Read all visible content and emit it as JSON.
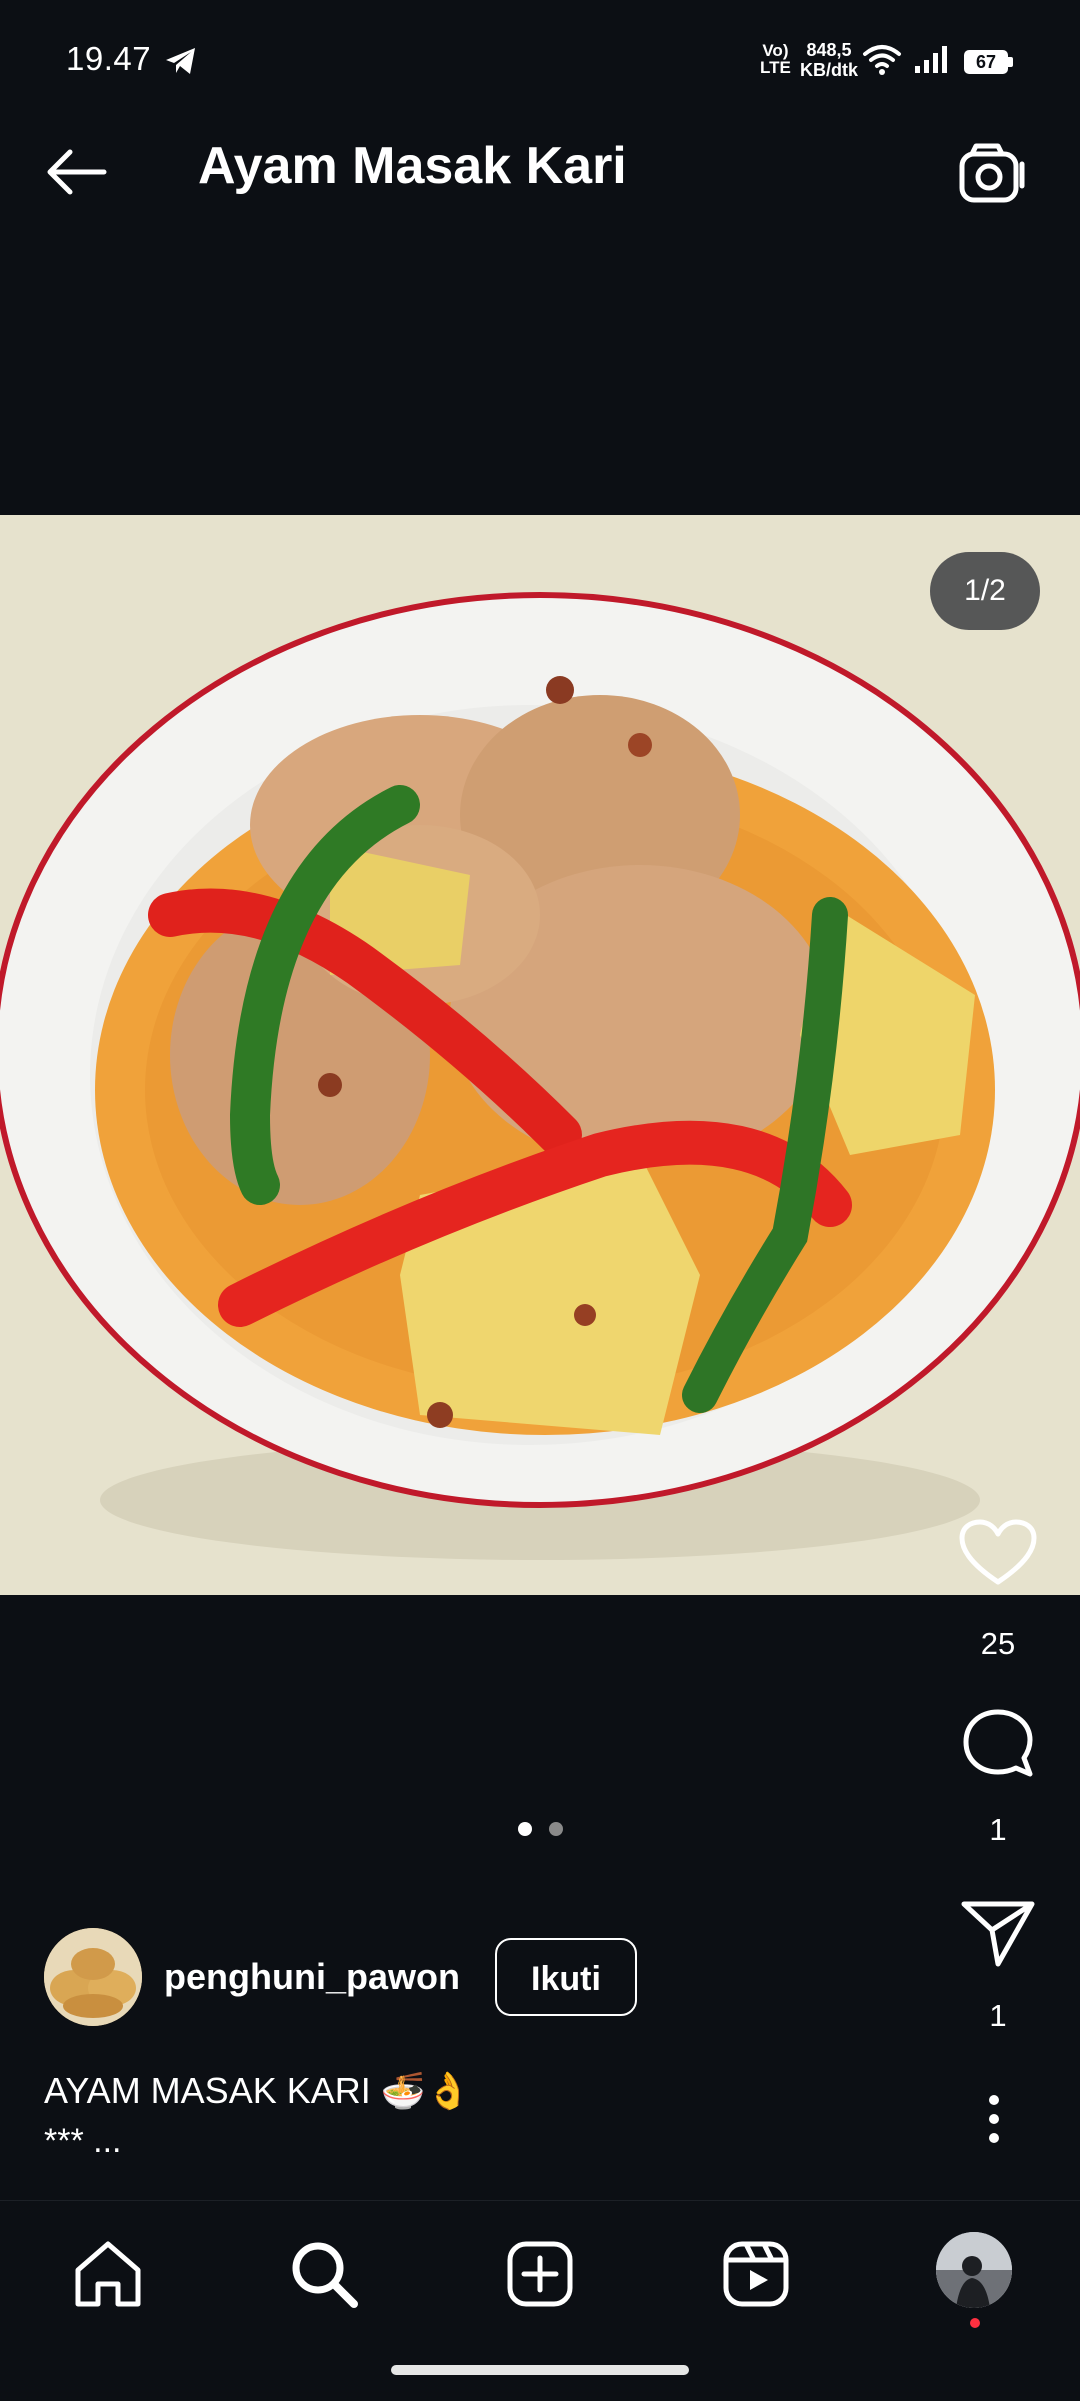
{
  "status_bar": {
    "time": "19.47",
    "net_top": "Vo)",
    "net_bottom": "LTE",
    "speed_value": "848,5",
    "speed_unit": "KB/dtk",
    "battery": "67"
  },
  "header": {
    "title": "Ayam Masak Kari"
  },
  "post": {
    "image_counter": "1/2",
    "likes": "25",
    "comments": "1",
    "shares": "1",
    "carousel_pages": 2,
    "active_page": 1,
    "author": "penghuni_pawon",
    "follow_label": "Ikuti",
    "caption_line1": "AYAM MASAK KARI 🍜👌",
    "caption_line2": "*** ..."
  },
  "colors": {
    "background": "#0c0f14",
    "notification_dot": "#ff3040"
  },
  "icons": [
    "back-arrow-icon",
    "camera-icon",
    "heart-icon",
    "comment-icon",
    "send-icon",
    "more-icon",
    "home-icon",
    "search-icon",
    "add-icon",
    "reels-icon",
    "profile-avatar"
  ]
}
